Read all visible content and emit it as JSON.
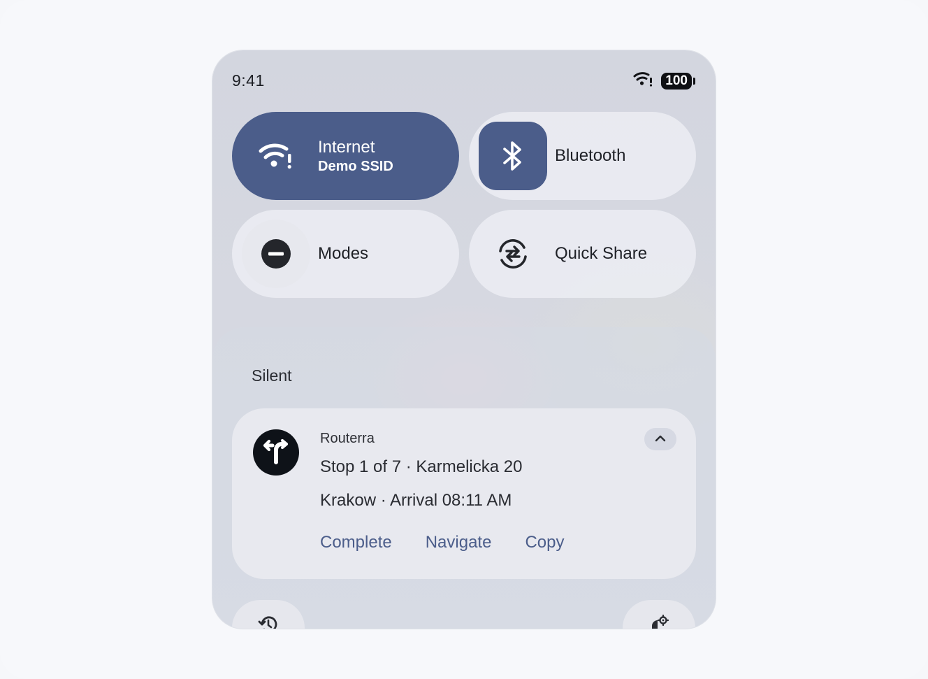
{
  "status_bar": {
    "time": "9:41",
    "battery": "100",
    "wifi_icon": "wifi-alert-icon"
  },
  "tiles": [
    {
      "label": "Internet",
      "sublabel": "Demo SSID",
      "active": true,
      "icon": "wifi-alert-icon"
    },
    {
      "label": "Bluetooth",
      "active": false,
      "icon": "bluetooth-icon"
    },
    {
      "label": "Modes",
      "active": false,
      "icon": "do-not-disturb-icon"
    },
    {
      "label": "Quick Share",
      "active": false,
      "icon": "quick-share-icon"
    }
  ],
  "notifications": {
    "section_title": "Silent",
    "card": {
      "app_name": "Routerra",
      "line1": "Stop 1 of 7 · Karmelicka 20",
      "line2": "Krakow · Arrival 08:11 AM",
      "actions": [
        "Complete",
        "Navigate",
        "Copy"
      ],
      "app_icon": "turn-arrow-icon"
    }
  },
  "bottom_buttons": {
    "left_icon": "history-icon",
    "right_icon": "notification-settings-icon"
  },
  "colors": {
    "accent": "#4b5d8a",
    "tile_bg": "#ecedf3",
    "card_bg": "#e8e9ef"
  }
}
